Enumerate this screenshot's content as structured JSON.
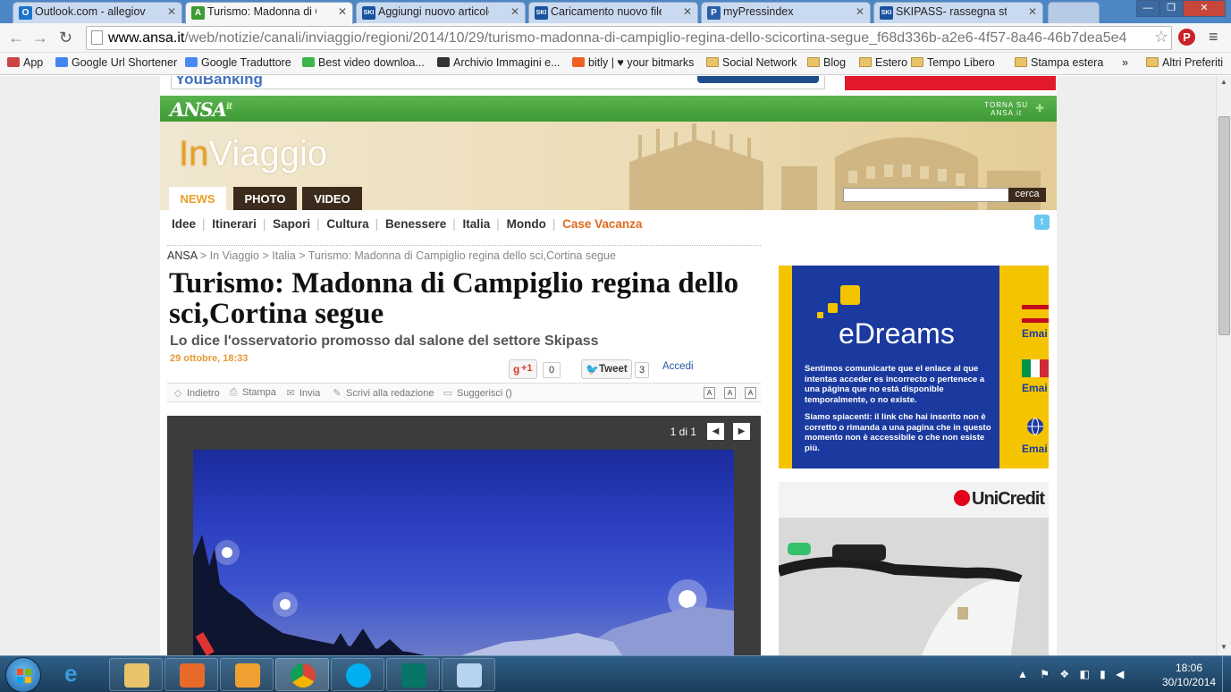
{
  "browser": {
    "tabs": [
      {
        "title": "Outlook.com - allegiova@",
        "favicon": "outlook-favicon",
        "color": "#1a74c9",
        "letter": "O"
      },
      {
        "title": "Turismo: Madonna di Can",
        "favicon": "ansa-favicon",
        "color": "#3e9a34",
        "letter": "A"
      },
      {
        "title": "Aggiungi nuovo articolo",
        "favicon": "ski-favicon",
        "color": "#1a52a0",
        "letter": "SKI"
      },
      {
        "title": "Caricamento nuovo file m",
        "favicon": "ski-favicon",
        "color": "#1a52a0",
        "letter": "SKI"
      },
      {
        "title": "myPressindex",
        "favicon": "pressindex-favicon",
        "color": "#2b5ea8",
        "letter": "P"
      },
      {
        "title": "SKIPASS- rassegna stamp",
        "favicon": "ski-favicon",
        "color": "#1a52a0",
        "letter": "SKI"
      }
    ],
    "url_host": "www.ansa.it",
    "url_path": "/web/notizie/canali/inviaggio/regioni/2014/10/29/turismo-madonna-di-campiglio-regina-dello-scicortina-segue_f68d336b-a2e6-4f57-8a46-46b7dea5e4",
    "bookmarks": [
      {
        "label": "App",
        "icon": "apps-grid-icon"
      },
      {
        "label": "Google Url Shortener",
        "icon": "google-icon"
      },
      {
        "label": "Google Traduttore",
        "icon": "translate-icon"
      },
      {
        "label": "Best video downloa...",
        "icon": "download-icon"
      },
      {
        "label": "Archivio Immagini e...",
        "icon": "image-archive-icon"
      },
      {
        "label": "bitly | ♥ your bitmarks",
        "icon": "bitly-icon"
      },
      {
        "label": "Social Network",
        "icon": "folder-icon"
      },
      {
        "label": "Blog",
        "icon": "folder-icon"
      },
      {
        "label": "Estero",
        "icon": "folder-icon"
      },
      {
        "label": "Tempo Libero",
        "icon": "folder-icon"
      },
      {
        "label": "Stampa estera",
        "icon": "folder-icon"
      },
      {
        "label": "Altri Preferiti",
        "icon": "folder-icon"
      }
    ],
    "bookmarks_more": "»"
  },
  "site": {
    "logo": "ANSA",
    "logo_suffix": "it",
    "torna_line1": "TORNA SU",
    "torna_line2": "ANSA.it",
    "brand_in": "In",
    "brand_rest": "Viaggio",
    "nav_tabs": [
      "NEWS",
      "PHOTO",
      "VIDEO"
    ],
    "search_button": "cerca",
    "categories": [
      "Idee",
      "Itinerari",
      "Sapori",
      "Cultura",
      "Benessere",
      "Italia",
      "Mondo",
      "Case Vacanza"
    ],
    "top_ad_text": "YouBanking"
  },
  "article": {
    "breadcrumb": [
      "ANSA",
      "In Viaggio",
      "Italia",
      "Turismo: Madonna di Campiglio regina dello sci,Cortina segue"
    ],
    "breadcrumb_sep": ">",
    "title": "Turismo: Madonna di Campiglio regina dello sci,Cortina segue",
    "subtitle": "Lo dice l'osservatorio promosso dal salone del settore Skipass",
    "date": "29 ottobre, 18:33",
    "gplus_label": "+1",
    "gplus_count": "0",
    "tweet_label": "Tweet",
    "tweet_count": "3",
    "login": "Accedi",
    "tools": [
      "Indietro",
      "Stampa",
      "Invia",
      "Scrivi alla redazione",
      "Suggerisci ()"
    ],
    "font_sizes": [
      "A",
      "A",
      "A"
    ],
    "gallery_counter": "1 di 1"
  },
  "ads": {
    "edreams_logo": "eDreams",
    "edreams_text1": "Sentimos comunicarte que el enlace al que intentas acceder es incorrecto o pertenece a una página que no está disponible temporalmente, o no existe.",
    "edreams_text2": "Siamo spiacenti: il link che hai inserito non è corretto o rimanda a una pagina che in questo momento non è accessibile o che non esiste più.",
    "edreams_side": [
      "Emai",
      "Emai",
      "Emai"
    ],
    "unicredit_logo": "UniCredit"
  },
  "taskbar": {
    "time": "18:06",
    "date": "30/10/2014"
  }
}
